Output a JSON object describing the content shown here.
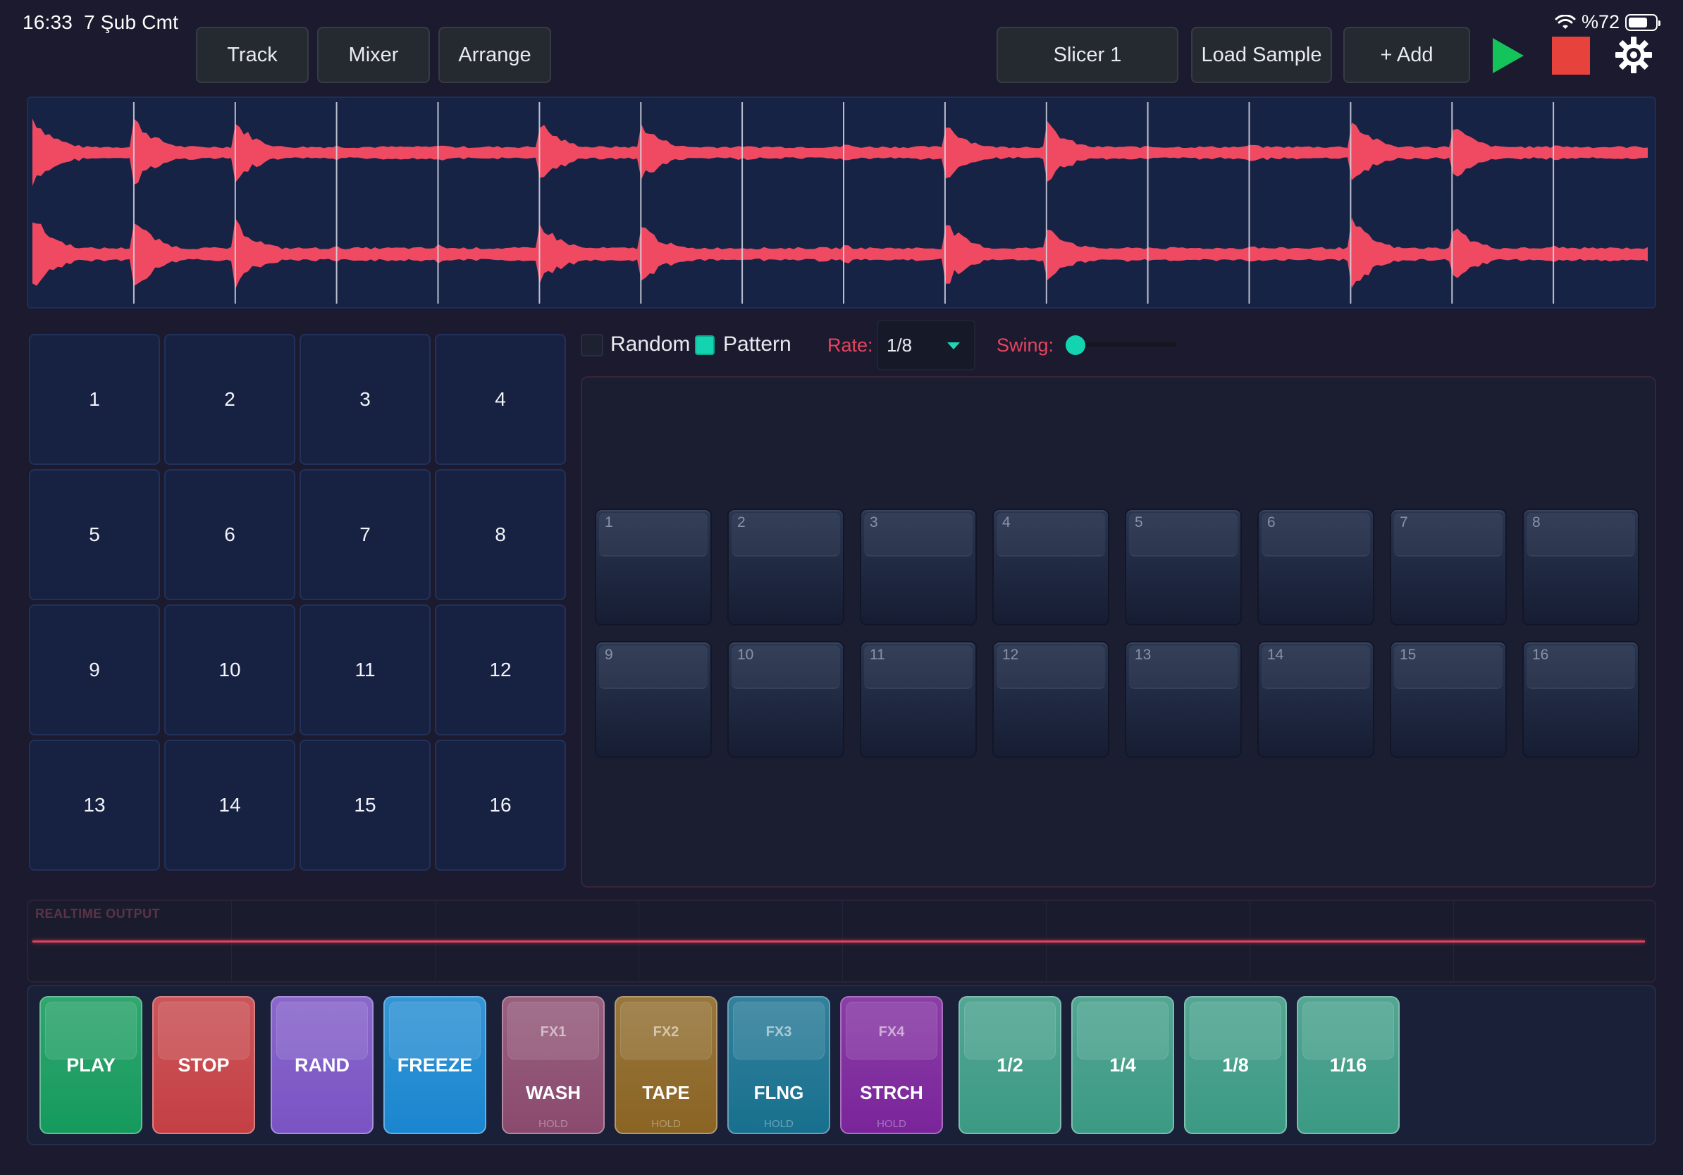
{
  "status": {
    "time": "16:33",
    "date": "7 Şub Cmt",
    "battery": "%72",
    "battery_level": 0.72
  },
  "nav_tabs": [
    "Track",
    "Mixer",
    "Arrange"
  ],
  "toolbar": {
    "instrument": "Slicer 1",
    "load_sample": "Load Sample",
    "add": "+ Add",
    "play_icon": "play-icon",
    "stop_icon": "stop-icon",
    "settings_icon": "gear-icon",
    "colors": {
      "play": "#15c35b",
      "stop": "#e8423d"
    }
  },
  "waveform": {
    "color": "#ef4a62",
    "slices": 16
  },
  "pads": [
    "1",
    "2",
    "3",
    "4",
    "5",
    "6",
    "7",
    "8",
    "9",
    "10",
    "11",
    "12",
    "13",
    "14",
    "15",
    "16"
  ],
  "controls": {
    "random_label": "Random",
    "random_checked": false,
    "pattern_label": "Pattern",
    "pattern_checked": true,
    "rate_label": "Rate:",
    "rate_value": "1/8",
    "swing_label": "Swing:",
    "swing_value": 0,
    "accent": "#12d4b0"
  },
  "steps": [
    "1",
    "2",
    "3",
    "4",
    "5",
    "6",
    "7",
    "8",
    "9",
    "10",
    "11",
    "12",
    "13",
    "14",
    "15",
    "16"
  ],
  "realtime": {
    "label": "REALTIME OUTPUT"
  },
  "perf_buttons": [
    {
      "label": "PLAY",
      "color": "#159a5c"
    },
    {
      "label": "STOP",
      "color": "#c43f44"
    },
    {
      "label": "RAND",
      "color": "#7a53c4"
    },
    {
      "label": "FREEZE",
      "color": "#1a86cf"
    },
    {
      "tag": "FX1",
      "label": "WASH",
      "hold": "HOLD",
      "color": "#8a4a6e"
    },
    {
      "tag": "FX2",
      "label": "TAPE",
      "hold": "HOLD",
      "color": "#8a6423"
    },
    {
      "tag": "FX3",
      "label": "FLNG",
      "hold": "HOLD",
      "color": "#17708e"
    },
    {
      "tag": "FX4",
      "label": "STRCH",
      "hold": "HOLD",
      "color": "#7a249a"
    },
    {
      "label": "1/2",
      "color": "#3b9a84"
    },
    {
      "label": "1/4",
      "color": "#3b9a84"
    },
    {
      "label": "1/8",
      "color": "#3b9a84"
    },
    {
      "label": "1/16",
      "color": "#3b9a84"
    }
  ]
}
